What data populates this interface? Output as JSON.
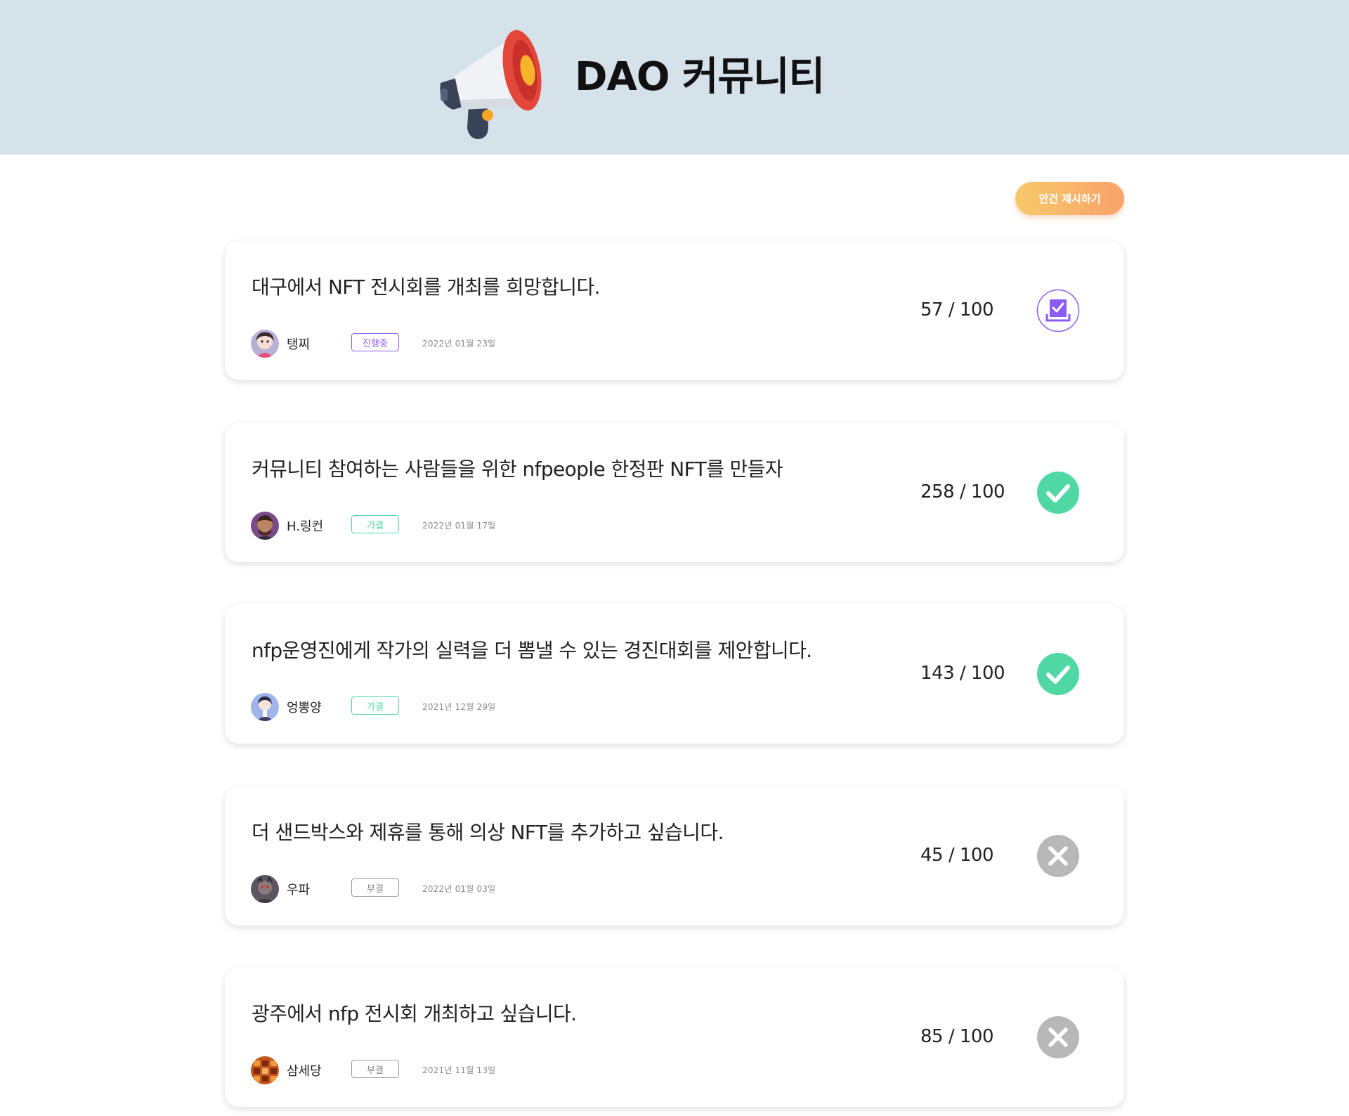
{
  "header": {
    "title": "DAO 커뮤니티",
    "icon": "megaphone-icon"
  },
  "toolbar": {
    "propose_label": "안건 제시하기"
  },
  "colors": {
    "header_bg": "#d6e2ea",
    "in_progress": "#8b5cf6",
    "approved": "#4fd8a4",
    "rejected": "#b8b8b8",
    "button_gradient_start": "#f7c96a",
    "button_gradient_end": "#f9a36b"
  },
  "proposals": [
    {
      "title": "대구에서 NFT 전시회를 개최를 희망합니다.",
      "author": "탱찌",
      "status": "진행중",
      "status_type": "in_progress",
      "date": "2022년  01월  23일",
      "votes": "57 / 100",
      "icon": "vote-box-icon"
    },
    {
      "title": "커뮤니티 참여하는 사람들을 위한 nfpeople 한정판 NFT를 만들자",
      "author": "H.링컨",
      "status": "가결",
      "status_type": "approved",
      "date": "2022년  01월  17일",
      "votes": "258 / 100",
      "icon": "check-circle-icon"
    },
    {
      "title": "nfp운영진에게 작가의 실력을 더 뽐낼 수 있는 경진대회를 제안합니다.",
      "author": "엉뽕양",
      "status": "가결",
      "status_type": "approved",
      "date": "2021년  12월  29일",
      "votes": "143 / 100",
      "icon": "check-circle-icon"
    },
    {
      "title": "더 샌드박스와 제휴를 통해 의상 NFT를 추가하고 싶습니다.",
      "author": "우파",
      "status": "부결",
      "status_type": "rejected",
      "date": "2022년  01월  03일",
      "votes": "45 / 100",
      "icon": "x-circle-icon"
    },
    {
      "title": "광주에서 nfp 전시회 개최하고 싶습니다.",
      "author": "삼세당",
      "status": "부결",
      "status_type": "rejected",
      "date": "2021년  11월  13일",
      "votes": "85 / 100",
      "icon": "x-circle-icon"
    }
  ]
}
